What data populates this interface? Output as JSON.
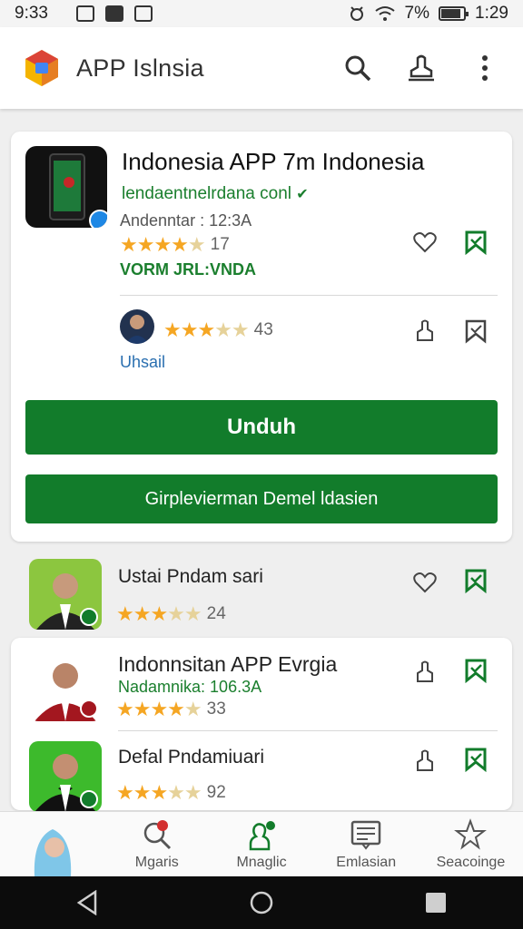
{
  "status": {
    "time": "9:33",
    "battery": "7%",
    "clock": "1:29"
  },
  "appbar": {
    "title": "APP Islnsia"
  },
  "featured": {
    "title": "Indonesia APP 7m Indonesia",
    "developer": "lendaentnelrdana conl",
    "meta": "Andenntar : 12:3A",
    "rating": "17",
    "tag": "VORM JRL:VNDA",
    "review_rating": "43",
    "review_link": "Uhsail",
    "primary_button": "Unduh",
    "secondary_button": "Girplevierman Demel ldasien"
  },
  "list": [
    {
      "title": "Ustai Pndam sari",
      "sub": "",
      "rating": "24"
    },
    {
      "title": "Indonnsitan APP Evrgia",
      "sub": "Nadamnika: 106.3A",
      "rating": "33"
    },
    {
      "title": "Defal Pndamiuari",
      "sub": "",
      "rating": "92"
    }
  ],
  "bottom_nav": [
    {
      "label": ""
    },
    {
      "label": "Mgaris"
    },
    {
      "label": "Mnaglic"
    },
    {
      "label": "Emlasian"
    },
    {
      "label": "Seacoinge"
    }
  ],
  "colors": {
    "accent": "#127c2b",
    "star": "#f5a623",
    "link": "#2a6fb0"
  }
}
